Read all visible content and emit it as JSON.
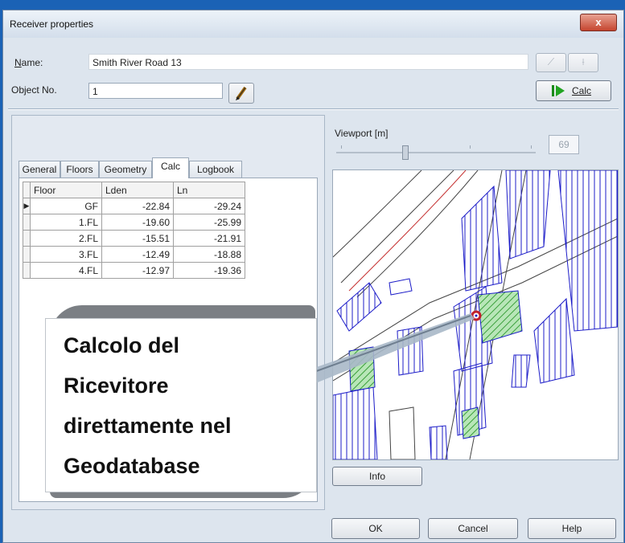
{
  "window": {
    "title": "Receiver properties",
    "close_label": "x"
  },
  "form": {
    "name_label": "Name:",
    "name_value": "Smith River Road 13",
    "object_no_label": "Object No.",
    "object_no_value": "1",
    "calc_button": "Calc"
  },
  "tabs": [
    "General",
    "Floors",
    "Geometry",
    "Calc",
    "Logbook"
  ],
  "active_tab": "Calc",
  "table": {
    "columns": [
      "Floor",
      "Lden",
      "Ln"
    ],
    "rows": [
      {
        "floor": "GF",
        "lden": "-22.84",
        "ln": "-29.24"
      },
      {
        "floor": "1.FL",
        "lden": "-19.60",
        "ln": "-25.99"
      },
      {
        "floor": "2.FL",
        "lden": "-15.51",
        "ln": "-21.91"
      },
      {
        "floor": "3.FL",
        "lden": "-12.49",
        "ln": "-18.88"
      },
      {
        "floor": "4.FL",
        "lden": "-12.97",
        "ln": "-19.36"
      }
    ]
  },
  "viewport": {
    "label": "Viewport [m]",
    "value": "69"
  },
  "buttons": {
    "info": "Info",
    "ok": "OK",
    "cancel": "Cancel",
    "help": "Help"
  },
  "callout": {
    "lines": [
      "Calcolo del",
      "Ricevitore",
      "direttamente nel",
      "Geodatabase"
    ]
  },
  "colors": {
    "desktop": "#1b62b5",
    "buildings": "#1c1cc8",
    "receiver": "#c0202a",
    "green_fill": "#8fd28f"
  }
}
